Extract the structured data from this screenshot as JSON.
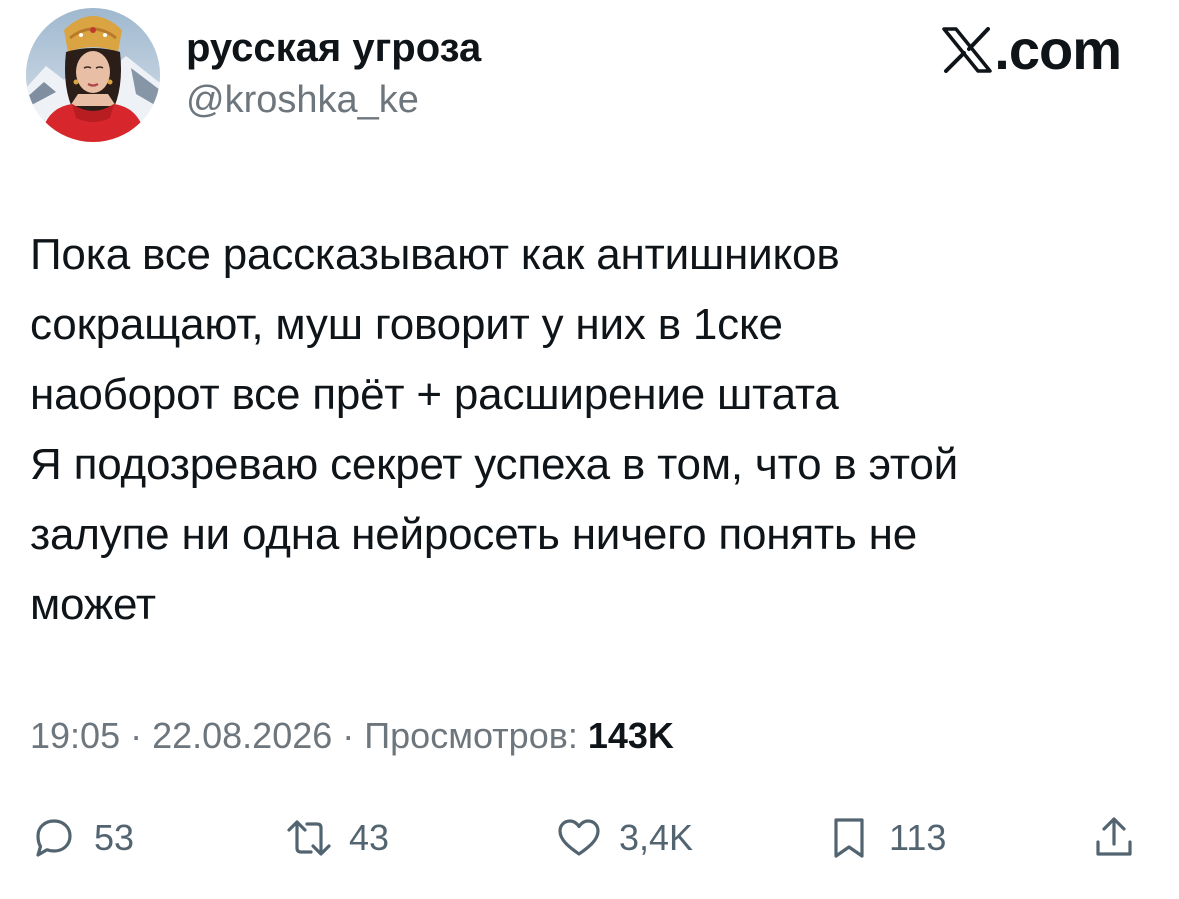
{
  "author": {
    "display_name": "русская угроза",
    "handle": "@kroshka_ke",
    "avatar_icon": "avatar-photo"
  },
  "brand": {
    "label": ".com",
    "icon": "x-logo-icon"
  },
  "tweet": {
    "text": "Пока все рассказывают как антишников\nсокращают, муш говорит у них в 1ске\nнаоборот все прёт + расширение штата\nЯ подозреваю секрет успеха в том, что в этой\nзалупе ни одна нейросеть ничего понять не\nможет"
  },
  "meta": {
    "time": "19:05",
    "separator": " · ",
    "date": "22.08.2026",
    "views_label": "Просмотров:",
    "views_count": "143K"
  },
  "actions": {
    "reply": {
      "icon": "reply-icon",
      "count": "53"
    },
    "repost": {
      "icon": "repost-icon",
      "count": "43"
    },
    "like": {
      "icon": "heart-icon",
      "count": "3,4K"
    },
    "bookmark": {
      "icon": "bookmark-icon",
      "count": "113"
    },
    "share": {
      "icon": "share-icon"
    }
  },
  "colors": {
    "text": "#0f1419",
    "secondary": "#6e767d",
    "icon": "#536471",
    "background": "#ffffff"
  }
}
